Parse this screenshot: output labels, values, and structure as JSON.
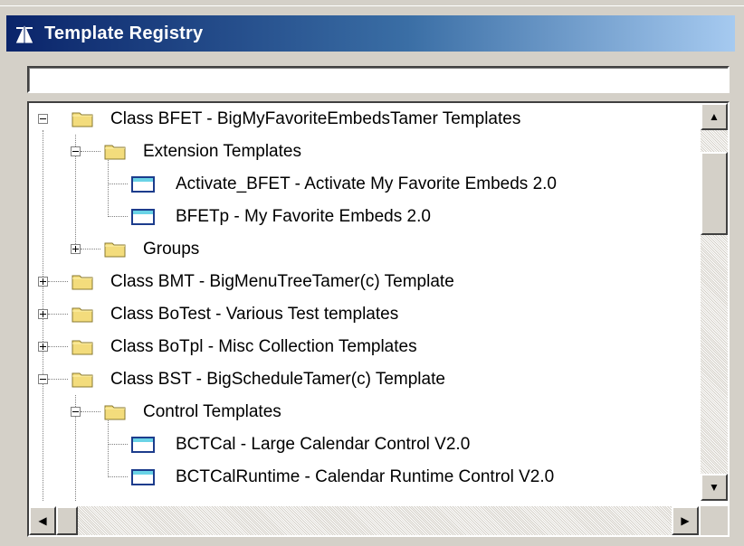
{
  "window": {
    "title": "Template Registry"
  },
  "search": {
    "value": "",
    "placeholder": ""
  },
  "tree": {
    "rows": [
      {
        "label": "Class BFET - BigMyFavoriteEmbedsTamer Templates",
        "type": "folder",
        "expander": "minus"
      },
      {
        "label": "Extension Templates",
        "type": "folder",
        "expander": "minus"
      },
      {
        "label": "Activate_BFET - Activate My Favorite Embeds 2.0",
        "type": "template"
      },
      {
        "label": "BFETp - My Favorite Embeds 2.0",
        "type": "template"
      },
      {
        "label": "Groups",
        "type": "folder",
        "expander": "plus"
      },
      {
        "label": "Class BMT - BigMenuTreeTamer(c) Template",
        "type": "folder",
        "expander": "plus"
      },
      {
        "label": "Class BoTest - Various Test templates",
        "type": "folder",
        "expander": "plus"
      },
      {
        "label": "Class BoTpl - Misc Collection Templates",
        "type": "folder",
        "expander": "plus"
      },
      {
        "label": "Class BST - BigScheduleTamer(c) Template",
        "type": "folder",
        "expander": "minus"
      },
      {
        "label": "Control Templates",
        "type": "folder",
        "expander": "minus"
      },
      {
        "label": "BCTCal - Large Calendar Control V2.0",
        "type": "template"
      },
      {
        "label": "BCTCalRuntime - Calendar Runtime Control V2.0",
        "type": "template"
      }
    ]
  },
  "colors": {
    "titlebar_start": "#0a246a",
    "titlebar_end": "#a6caf0",
    "folder": "#f3dc7c",
    "template_icon": "#6ad3e6",
    "window_bg": "#d4d0c8"
  },
  "icons": {
    "title": "wizard-icon",
    "folder": "folder-icon",
    "template": "window-template-icon"
  }
}
